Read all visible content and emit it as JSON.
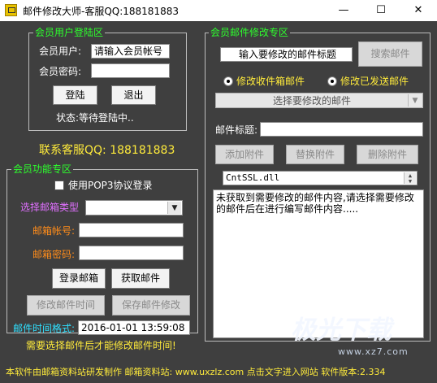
{
  "window": {
    "title": "邮件修改大师-客服QQ:188181883",
    "minimize": "—",
    "maximize": "☐",
    "close": "✕"
  },
  "login_panel": {
    "legend": "会员用户登陆区",
    "user_label": "会员用户:",
    "user_value": "请输入会员帐号",
    "password_label": "会员密码:",
    "password_value": "",
    "login_button": "登陆",
    "logout_button": "退出",
    "status": "状态:等待登陆中.."
  },
  "contact": "联系客服QQ: 188181883",
  "function_panel": {
    "legend": "会员功能专区",
    "pop3_label": "使用POP3协议登录",
    "pop3_checked": false,
    "mailbox_type_label": "选择邮箱类型",
    "mailbox_type_value": "",
    "account_label": "邮箱帐号:",
    "account_value": "",
    "mail_password_label": "邮箱密码:",
    "mail_password_value": "",
    "login_mailbox_button": "登录邮箱",
    "fetch_mail_button": "获取邮件",
    "modify_time_button": "修改邮件时间",
    "save_button": "保存邮件修改",
    "time_format_label": "邮件时间格式:",
    "time_value": "2016-01-01 13:59:08",
    "warning": "需要选择邮件后才能修改邮件时间!"
  },
  "edit_panel": {
    "legend": "会员邮件修改专区",
    "search_placeholder": "输入要修改的邮件标题",
    "search_button": "搜索邮件",
    "radio_inbox": "修改收件箱邮件",
    "radio_sent": "修改已发送邮件",
    "inbox_selected": false,
    "sent_selected": false,
    "select_mail": "选择要修改的邮件",
    "subject_label": "邮件标题:",
    "subject_value": "",
    "add_attachment": "添加附件",
    "replace_attachment": "替换附件",
    "delete_attachment": "删除附件",
    "attachment_value": "CntSSL.dll",
    "body_text": "未获取到需要修改的邮件内容,请选择需要修改的邮件后在进行编写邮件内容....."
  },
  "footer": "本软件由邮箱资料站研发制作 邮箱资料站: www.uxzlz.com 点击文字进入网站 软件版本:2.334",
  "watermark": {
    "text": "极光下载",
    "site": "www.xz7.com"
  },
  "colors": {
    "background": "#3f3f3f",
    "legend_green": "#2dff2d",
    "accent_yellow": "#ffeb3b",
    "label_orange": "#ff8c1a",
    "label_violet": "#e070ff",
    "label_cyan": "#2fe0ff"
  }
}
